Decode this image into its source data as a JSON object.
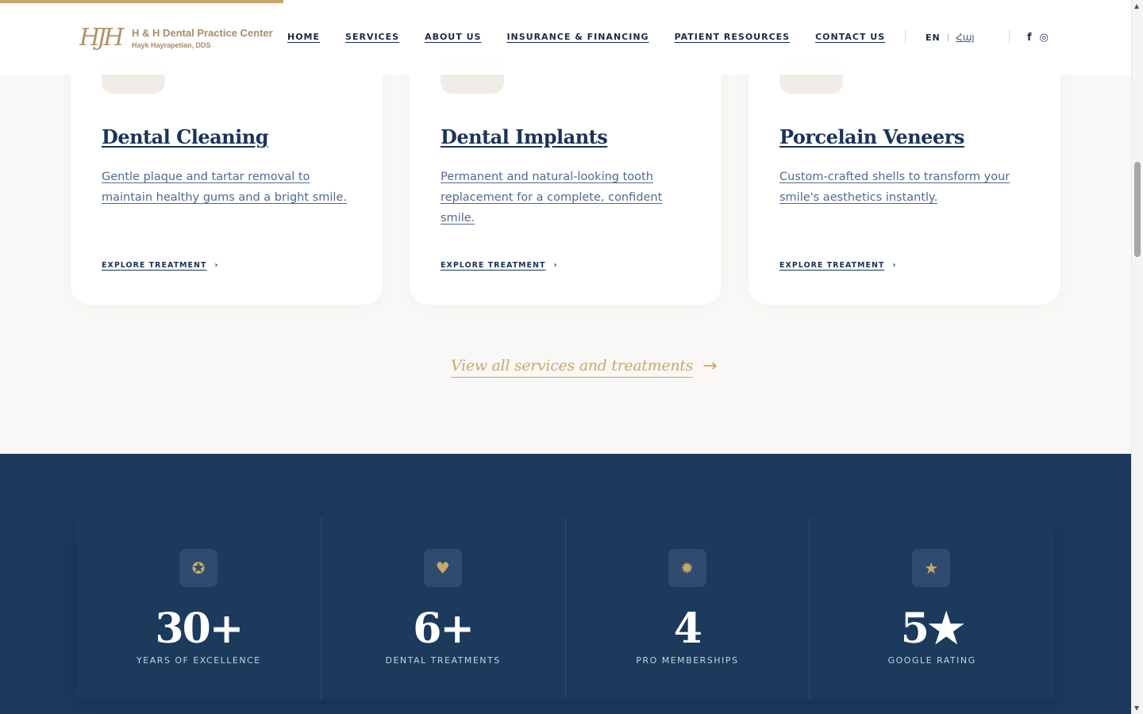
{
  "header": {
    "logo_mark": "HJH",
    "logo_name": "H & H Dental Practice Center",
    "logo_sub": "Hayk Hayrapetian, DDS",
    "nav": [
      "HOME",
      "SERVICES",
      "ABOUT US",
      "INSURANCE & FINANCING",
      "PATIENT RESOURCES",
      "CONTACT US"
    ],
    "lang_en": "EN",
    "lang_sep": "|",
    "lang_hy": "Հայ",
    "social": [
      "f",
      "◎"
    ]
  },
  "services": [
    {
      "title": "Dental Cleaning",
      "description": "Gentle plaque and tartar removal to maintain healthy gums and a bright smile.",
      "cta": "EXPLORE TREATMENT"
    },
    {
      "title": "Dental Implants",
      "description": "Permanent and natural-looking tooth replacement for a complete, confident smile.",
      "cta": "EXPLORE TREATMENT"
    },
    {
      "title": "Porcelain Veneers",
      "description": "Custom-crafted shells to transform your smile's aesthetics instantly.",
      "cta": "EXPLORE TREATMENT"
    }
  ],
  "view_all": {
    "label": "View all services and treatments",
    "arrow": "→"
  },
  "stats": [
    {
      "value": "30+",
      "label": "YEARS OF EXCELLENCE",
      "icon": "award-icon",
      "glyph": "✪"
    },
    {
      "value": "6+",
      "label": "DENTAL TREATMENTS",
      "icon": "tooth-icon",
      "glyph": "♥"
    },
    {
      "value": "4",
      "label": "PRO MEMBERSHIPS",
      "icon": "badge-icon",
      "glyph": "✹"
    },
    {
      "value": "5★",
      "label": "GOOGLE RATING",
      "icon": "star-icon",
      "glyph": "★"
    }
  ],
  "colors": {
    "navy": "#1b3a5c",
    "gold": "#c9a76a",
    "background": "#faf8f6"
  }
}
